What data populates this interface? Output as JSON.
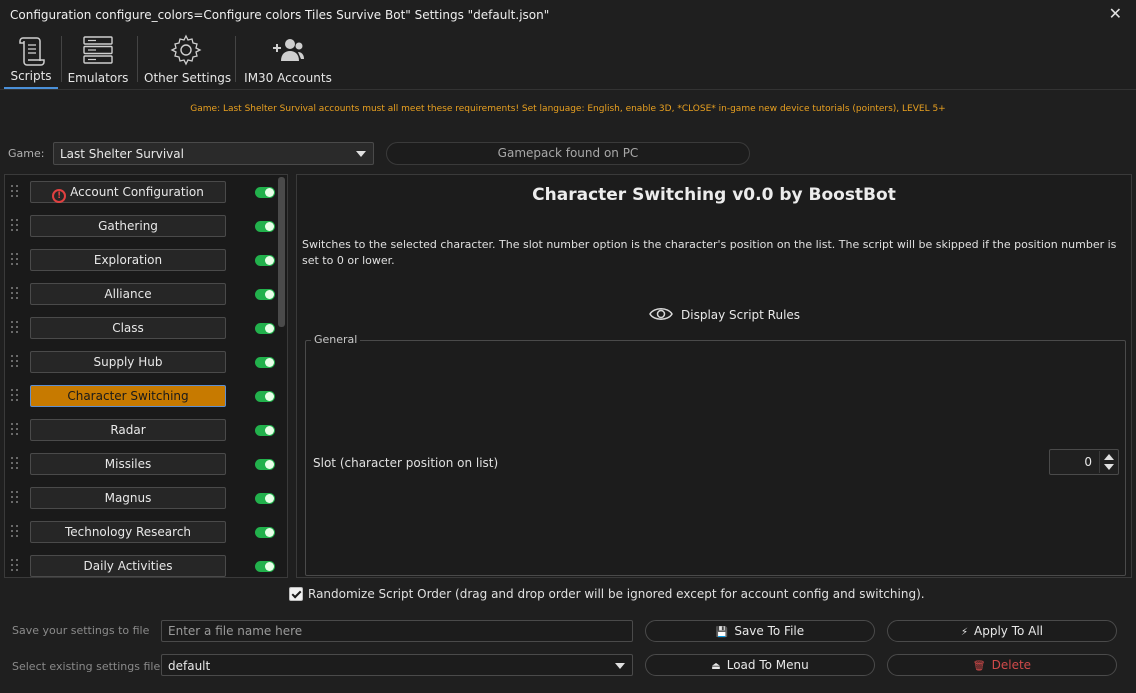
{
  "window": {
    "title": "Configuration configure_colors=Configure colors Tiles Survive Bot\" Settings \"default.json\"",
    "close_glyph": "✕"
  },
  "toolbar": {
    "tabs": [
      {
        "label": "Scripts",
        "icon": "scroll-icon",
        "active": true
      },
      {
        "label": "Emulators",
        "icon": "server-icon",
        "active": false
      },
      {
        "label": "Other Settings",
        "icon": "gear-icon",
        "active": false
      },
      {
        "label": "IM30 Accounts",
        "icon": "users-icon",
        "active": false
      }
    ]
  },
  "warning_text": "Game: Last Shelter Survival accounts must all meet these requirements! Set language: English, enable 3D, *CLOSE* in-game new device tutorials (pointers), LEVEL 5+",
  "game": {
    "label": "Game:",
    "selected": "Last Shelter Survival",
    "status": "Gamepack found on PC"
  },
  "scripts": [
    {
      "label": "Account Configuration",
      "warning_icon": true,
      "warning_glyph": "!",
      "enabled": true,
      "selected": false
    },
    {
      "label": "Gathering",
      "enabled": true,
      "selected": false
    },
    {
      "label": "Exploration",
      "enabled": true,
      "selected": false
    },
    {
      "label": "Alliance",
      "enabled": true,
      "selected": false
    },
    {
      "label": "Class",
      "enabled": true,
      "selected": false
    },
    {
      "label": "Supply Hub",
      "enabled": true,
      "selected": false
    },
    {
      "label": "Character Switching",
      "enabled": true,
      "selected": true
    },
    {
      "label": "Radar",
      "enabled": true,
      "selected": false
    },
    {
      "label": "Missiles",
      "enabled": true,
      "selected": false
    },
    {
      "label": "Magnus",
      "enabled": true,
      "selected": false
    },
    {
      "label": "Technology Research",
      "enabled": true,
      "selected": false
    },
    {
      "label": "Daily Activities",
      "enabled": true,
      "selected": false
    }
  ],
  "detail": {
    "title": "Character Switching v0.0 by BoostBot",
    "description": "Switches to the selected character. The slot number option is the character's position on the list. The script will be skipped if the position number is set to 0 or lower.",
    "rules_label": "Display Script Rules",
    "group_label": "General",
    "slot_label": "Slot (character position on list)",
    "slot_value": "0"
  },
  "randomize": {
    "checked": true,
    "label": "Randomize Script Order (drag and drop order will be ignored except for account config and switching)."
  },
  "footer": {
    "save_label": "Save your settings to file",
    "save_placeholder": "Enter a file name here",
    "save_button": "Save To File",
    "save_icon_glyph": "💾",
    "apply_button": "Apply To All",
    "apply_icon_glyph": "⚡",
    "select_label": "Select existing settings file",
    "select_value": "default",
    "load_button": "Load To Menu",
    "load_icon_glyph": "⏏",
    "delete_button": "Delete",
    "delete_icon_glyph": "🗑"
  },
  "colors": {
    "background": "#1f1f1f",
    "accent": "#c77a00",
    "toggle_on": "#22b14c",
    "warning": "#e8a020",
    "danger": "#d04a4a"
  }
}
